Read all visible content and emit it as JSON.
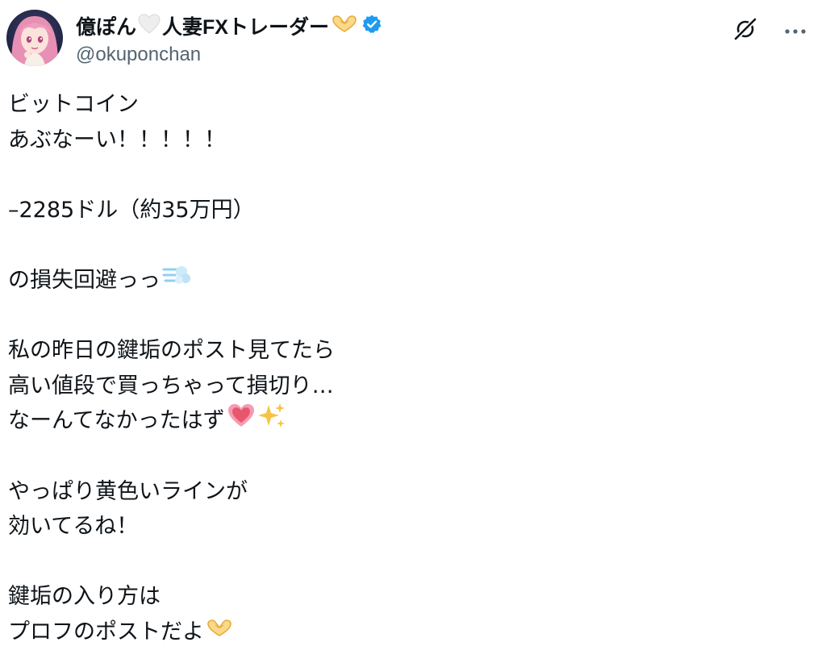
{
  "author": {
    "display_name_part1": "億ぽん",
    "display_name_part2": "人妻FXトレーダー",
    "handle": "@okuponchan",
    "verified": true,
    "avatar_icon": "anime-girl-avatar",
    "name_emoji_1": "white-heart-icon",
    "name_emoji_2": "heart-hands-icon"
  },
  "actions": {
    "grok_icon": "grok-icon",
    "more_icon": "more-horizontal-icon"
  },
  "post": {
    "lines": [
      "ビットコイン",
      "あぶなーい！！！！！",
      "",
      "–2285ドル（約35万円）",
      "",
      "の損失回避っっ",
      "",
      "私の昨日の鍵垢のポスト見てたら",
      "高い値段で買っちゃって損切り…",
      "なーんてなかったはず",
      "",
      "やっぱり黄色いラインが",
      "効いてるね！",
      "",
      "鍵垢の入り方は",
      "プロフのポストだよ"
    ],
    "emoji_dash": "dash-symbol-emoji",
    "emoji_heart": "growing-heart-emoji",
    "emoji_sparkles": "sparkles-emoji",
    "emoji_heart_hands": "heart-hands-emoji"
  },
  "colors": {
    "text": "#0f1419",
    "secondary": "#536471",
    "verified": "#1d9bf0"
  }
}
